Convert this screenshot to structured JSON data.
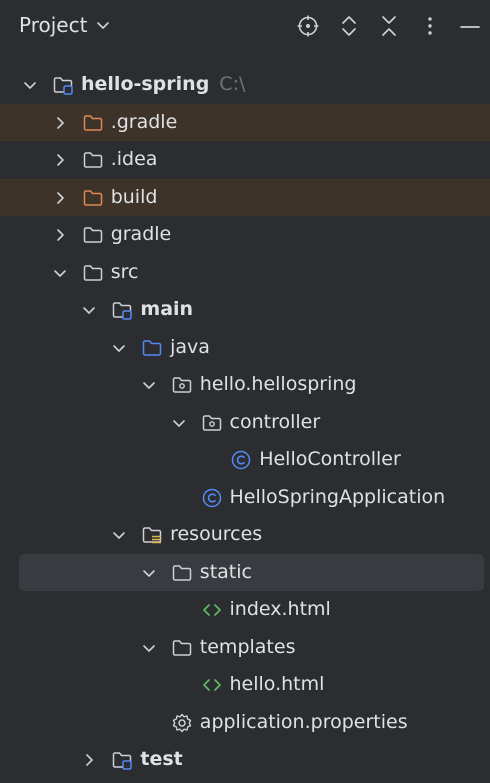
{
  "header": {
    "title": "Project",
    "buttons": [
      "locate-icon",
      "expand-all-icon",
      "collapse-all-icon",
      "more-icon",
      "minimize-icon"
    ]
  },
  "tree": [
    {
      "label": "hello-spring",
      "hint": "C:\\",
      "depth": 0,
      "expanded": true,
      "icon": "module-folder",
      "bold": true
    },
    {
      "label": ".gradle",
      "depth": 1,
      "expanded": false,
      "icon": "folder-excluded",
      "excluded": true
    },
    {
      "label": ".idea",
      "depth": 1,
      "expanded": false,
      "icon": "folder"
    },
    {
      "label": "build",
      "depth": 1,
      "expanded": false,
      "icon": "folder-excluded",
      "excluded": true
    },
    {
      "label": "gradle",
      "depth": 1,
      "expanded": false,
      "icon": "folder"
    },
    {
      "label": "src",
      "depth": 1,
      "expanded": true,
      "icon": "folder"
    },
    {
      "label": "main",
      "depth": 2,
      "expanded": true,
      "icon": "module-folder",
      "bold": true
    },
    {
      "label": "java",
      "depth": 3,
      "expanded": true,
      "icon": "source-folder"
    },
    {
      "label": "hello.hellospring",
      "depth": 4,
      "expanded": true,
      "icon": "package"
    },
    {
      "label": "controller",
      "depth": 5,
      "expanded": true,
      "icon": "package"
    },
    {
      "label": "HelloController",
      "depth": 6,
      "leaf": true,
      "icon": "class"
    },
    {
      "label": "HelloSpringApplication",
      "depth": 5,
      "leaf": true,
      "icon": "class"
    },
    {
      "label": "resources",
      "depth": 3,
      "expanded": true,
      "icon": "resources-folder"
    },
    {
      "label": "static",
      "depth": 4,
      "expanded": true,
      "icon": "folder",
      "selected": true
    },
    {
      "label": "index.html",
      "depth": 5,
      "leaf": true,
      "icon": "html"
    },
    {
      "label": "templates",
      "depth": 4,
      "expanded": true,
      "icon": "folder"
    },
    {
      "label": "hello.html",
      "depth": 5,
      "leaf": true,
      "icon": "html"
    },
    {
      "label": "application.properties",
      "depth": 4,
      "leaf": true,
      "icon": "settings"
    },
    {
      "label": "test",
      "depth": 2,
      "expanded": false,
      "icon": "module-folder",
      "bold": true
    }
  ],
  "colors": {
    "background": "#2b2d30",
    "text": "#dfe1e5",
    "excluded_row": "#3d3328",
    "excluded_folder": "#e08855",
    "source_folder": "#548af7",
    "class_icon": "#548af7",
    "html_icon": "#5fb865",
    "hint": "#6f737a"
  }
}
